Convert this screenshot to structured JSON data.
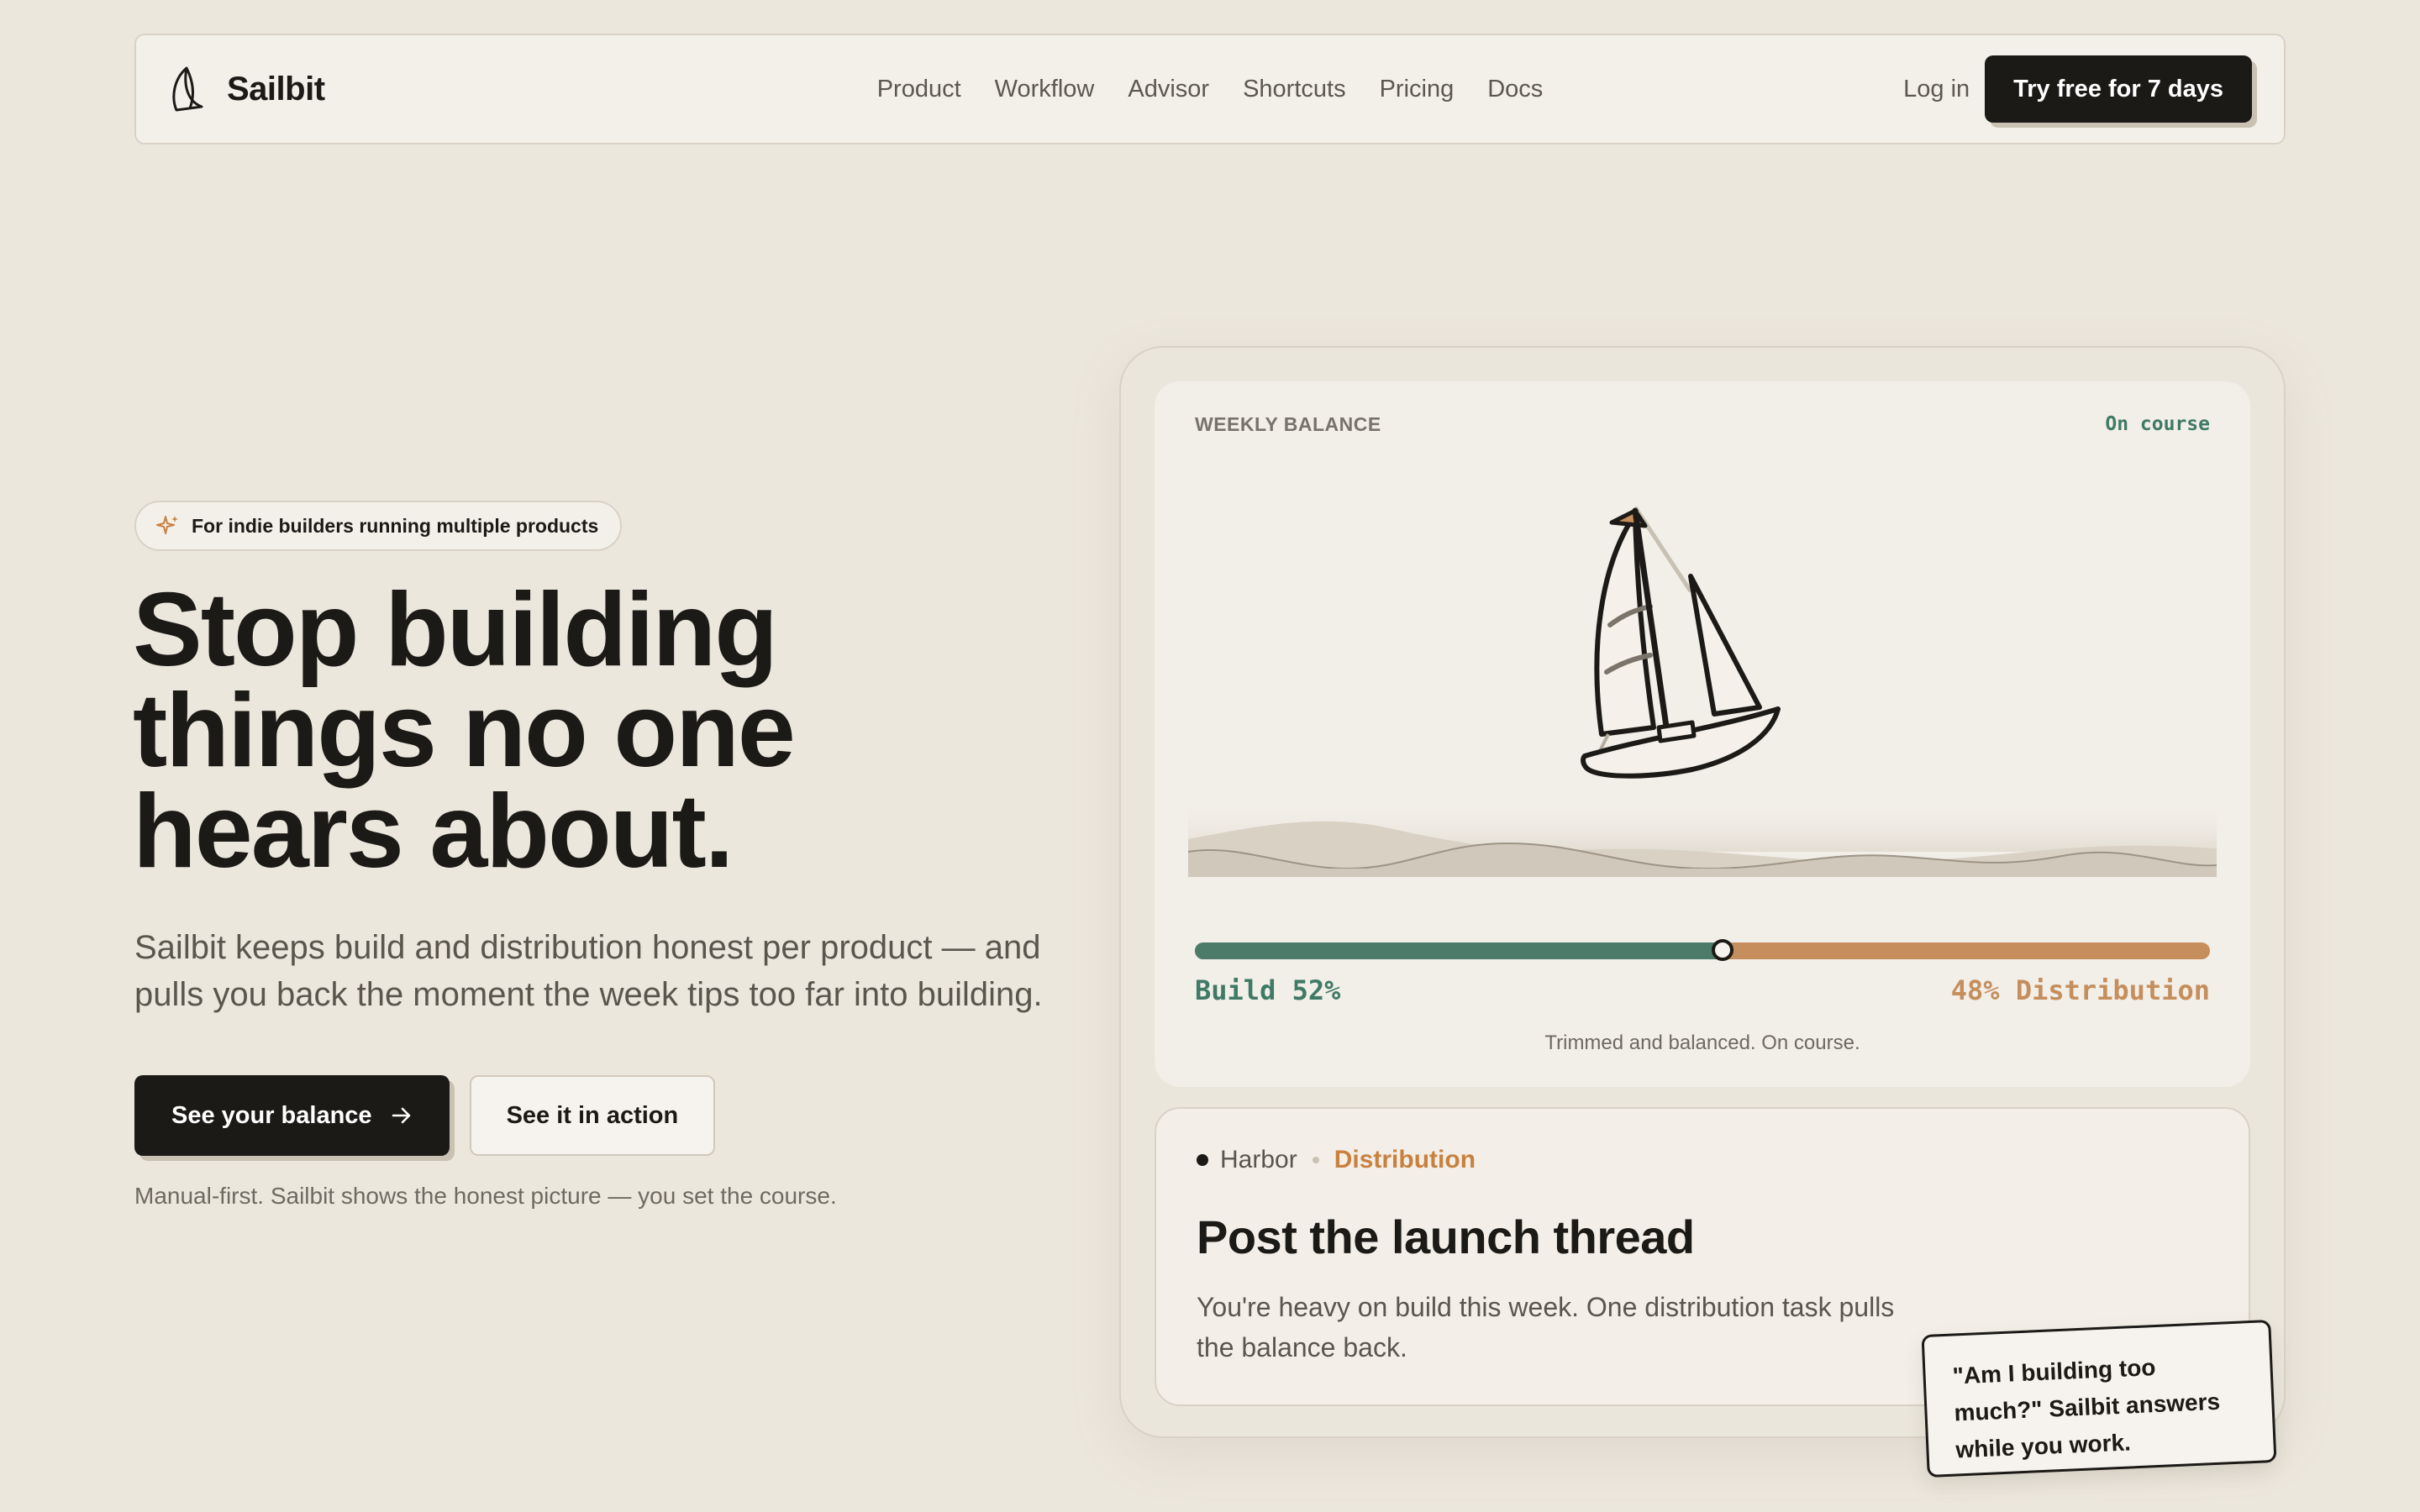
{
  "nav": {
    "brand": "Sailbit",
    "links": [
      "Product",
      "Workflow",
      "Advisor",
      "Shortcuts",
      "Pricing",
      "Docs"
    ],
    "login": "Log in",
    "cta": "Try free for 7 days"
  },
  "hero": {
    "badge": "For indie builders running multiple products",
    "headline_lines": [
      "Stop building",
      "things no one",
      "hears about."
    ],
    "subtext": "Sailbit keeps build and distribution honest per product — and pulls you back the moment the week tips too far into building.",
    "primary_cta": "See your balance",
    "secondary_cta": "See it in action",
    "fineprint": "Manual-first. Sailbit shows the honest picture — you set the course."
  },
  "balance": {
    "label": "WEEKLY BALANCE",
    "status": "On course",
    "build_percent": 52,
    "build_label": "Build 52%",
    "distribution_label": "48% Distribution",
    "caption": "Trimmed and balanced. On course."
  },
  "task": {
    "product": "Harbor",
    "type": "Distribution",
    "title": "Post the launch thread",
    "description": "You're heavy on build this week. One distribution task pulls the balance back."
  },
  "note": {
    "text": "\"Am I building too much?\" Sailbit answers while you work."
  },
  "colors": {
    "background": "#ece7dd",
    "build": "#4c7b6a",
    "distribution": "#c58e5c",
    "dark": "#1c1a17"
  },
  "icons": [
    "sail-logo-icon",
    "sparkle-icon",
    "arrow-right-icon",
    "sailboat-illustration"
  ]
}
